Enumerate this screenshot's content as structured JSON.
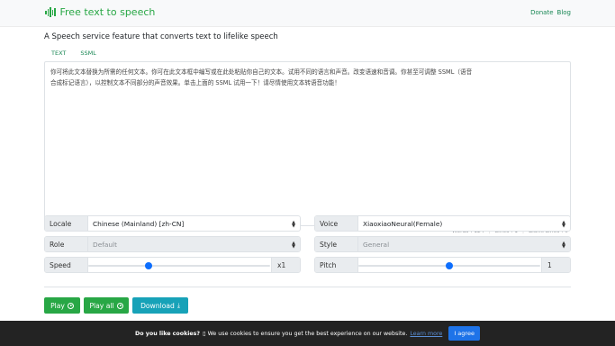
{
  "navbar": {
    "brand": "Free text to speech",
    "brand_icon": "waveform-icon",
    "links": [
      "Donate",
      "Blog"
    ]
  },
  "page": {
    "subtitle": "A Speech service feature that converts text to lifelike speech",
    "tabs": [
      {
        "label": "TEXT",
        "active": true
      },
      {
        "label": "SSML",
        "active": false
      }
    ]
  },
  "editor": {
    "line1": "你可将此文本替换为所需的任何文本。你可在此文本框中编写或在此处粘贴你自己的文本。试用不同的语言和声音。改变语速和音调。你甚至可调整 SSML（语音",
    "line2": "合成标记语言），以控制文本不同部分的声音效果。单击上面的 SSML 试用一下！请尽情使用文本转语音功能！"
  },
  "stats": {
    "words": "Words : 124",
    "lines": "Lines : 1",
    "blank": "Blank Lines : 0"
  },
  "controls": {
    "locale": {
      "label": "Locale",
      "value": "Chinese (Mainland) [zh-CN]"
    },
    "voice": {
      "label": "Voice",
      "value": "XiaoxiaoNeural(Female)"
    },
    "role": {
      "label": "Role",
      "value": "Default"
    },
    "style": {
      "label": "Style",
      "value": "General"
    },
    "speed": {
      "label": "Speed",
      "value_text": "x1",
      "level": 0.33
    },
    "pitch": {
      "label": "Pitch",
      "value_text": "1",
      "level": 0.5
    }
  },
  "buttons": {
    "play": "Play",
    "play_all": "Play all",
    "download": "Download"
  },
  "cookie": {
    "title": "Do you like cookies?",
    "message": "We use cookies to ensure you get the best experience on our website.",
    "learn_more": "Learn more",
    "agree": "I agree"
  },
  "colors": {
    "brand_green": "#28a745",
    "download_teal": "#17a2b8",
    "slider_blue": "#0d6efd",
    "cookie_bg": "#232323",
    "agree_blue": "#1e73e8"
  }
}
